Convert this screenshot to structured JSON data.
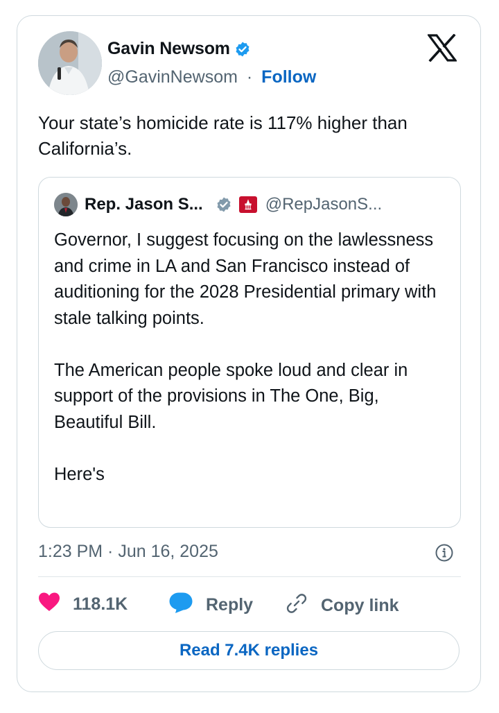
{
  "author": {
    "name": "Gavin Newsom",
    "handle": "@GavinNewsom",
    "separator": "·",
    "follow_label": "Follow"
  },
  "tweet": {
    "text": "Your state’s homicide rate is 117% higher than California’s."
  },
  "quoted_tweet": {
    "name": "Rep. Jason S...",
    "handle": "@RepJasonS...",
    "paragraphs": [
      "Governor, I suggest focusing on the lawlessness and crime in LA and San Francisco instead of auditioning for the 2028 Presidential primary with stale talking points.",
      "The American people spoke loud and clear in support of the provisions in The One, Big, Beautiful Bill.",
      "Here's"
    ]
  },
  "timestamp": "1:23 PM · Jun 16, 2025",
  "actions": {
    "likes": "118.1K",
    "reply_label": "Reply",
    "copy_link_label": "Copy link"
  },
  "read_replies_label": "Read 7.4K replies",
  "colors": {
    "accent": "#0a66c2",
    "verified": "#1d9bf0",
    "like": "#f91880",
    "secondary_text": "#536471",
    "border": "#cfd9de"
  },
  "icons": [
    "verified-badge-icon",
    "x-logo-icon",
    "gray-verified-badge-icon",
    "congress-flag-icon",
    "info-icon",
    "heart-icon",
    "reply-bubble-icon",
    "link-icon"
  ]
}
